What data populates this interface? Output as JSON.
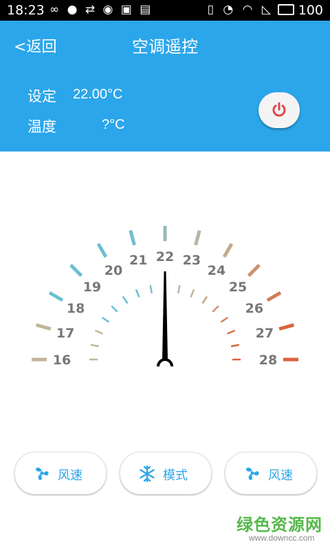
{
  "status_bar": {
    "time": "18:23",
    "battery": "100"
  },
  "header": {
    "back_label": "返回",
    "title": "空调遥控"
  },
  "info": {
    "set_label": "设定",
    "set_value": "22.00°C",
    "temp_label": "温度",
    "temp_value": "?°C"
  },
  "dial": {
    "min": 16,
    "max": 28,
    "current": 22,
    "tick_labels": [
      "16",
      "17",
      "18",
      "19",
      "20",
      "21",
      "22",
      "23",
      "24",
      "25",
      "26",
      "27",
      "28"
    ],
    "colors": {
      "cool": "#6BBFD2",
      "neutral": "#C2B59A",
      "warm": "#D9633A",
      "needle": "#000000"
    }
  },
  "buttons": [
    {
      "label": "风速",
      "icon": "fan-icon"
    },
    {
      "label": "模式",
      "icon": "snowflake-icon"
    },
    {
      "label": "风速",
      "icon": "fan-icon"
    }
  ],
  "watermark": {
    "brand": "绿色资源网",
    "url": "www.downcc.com"
  },
  "colors": {
    "accent": "#2BA6EA",
    "power": "#E0474C"
  }
}
